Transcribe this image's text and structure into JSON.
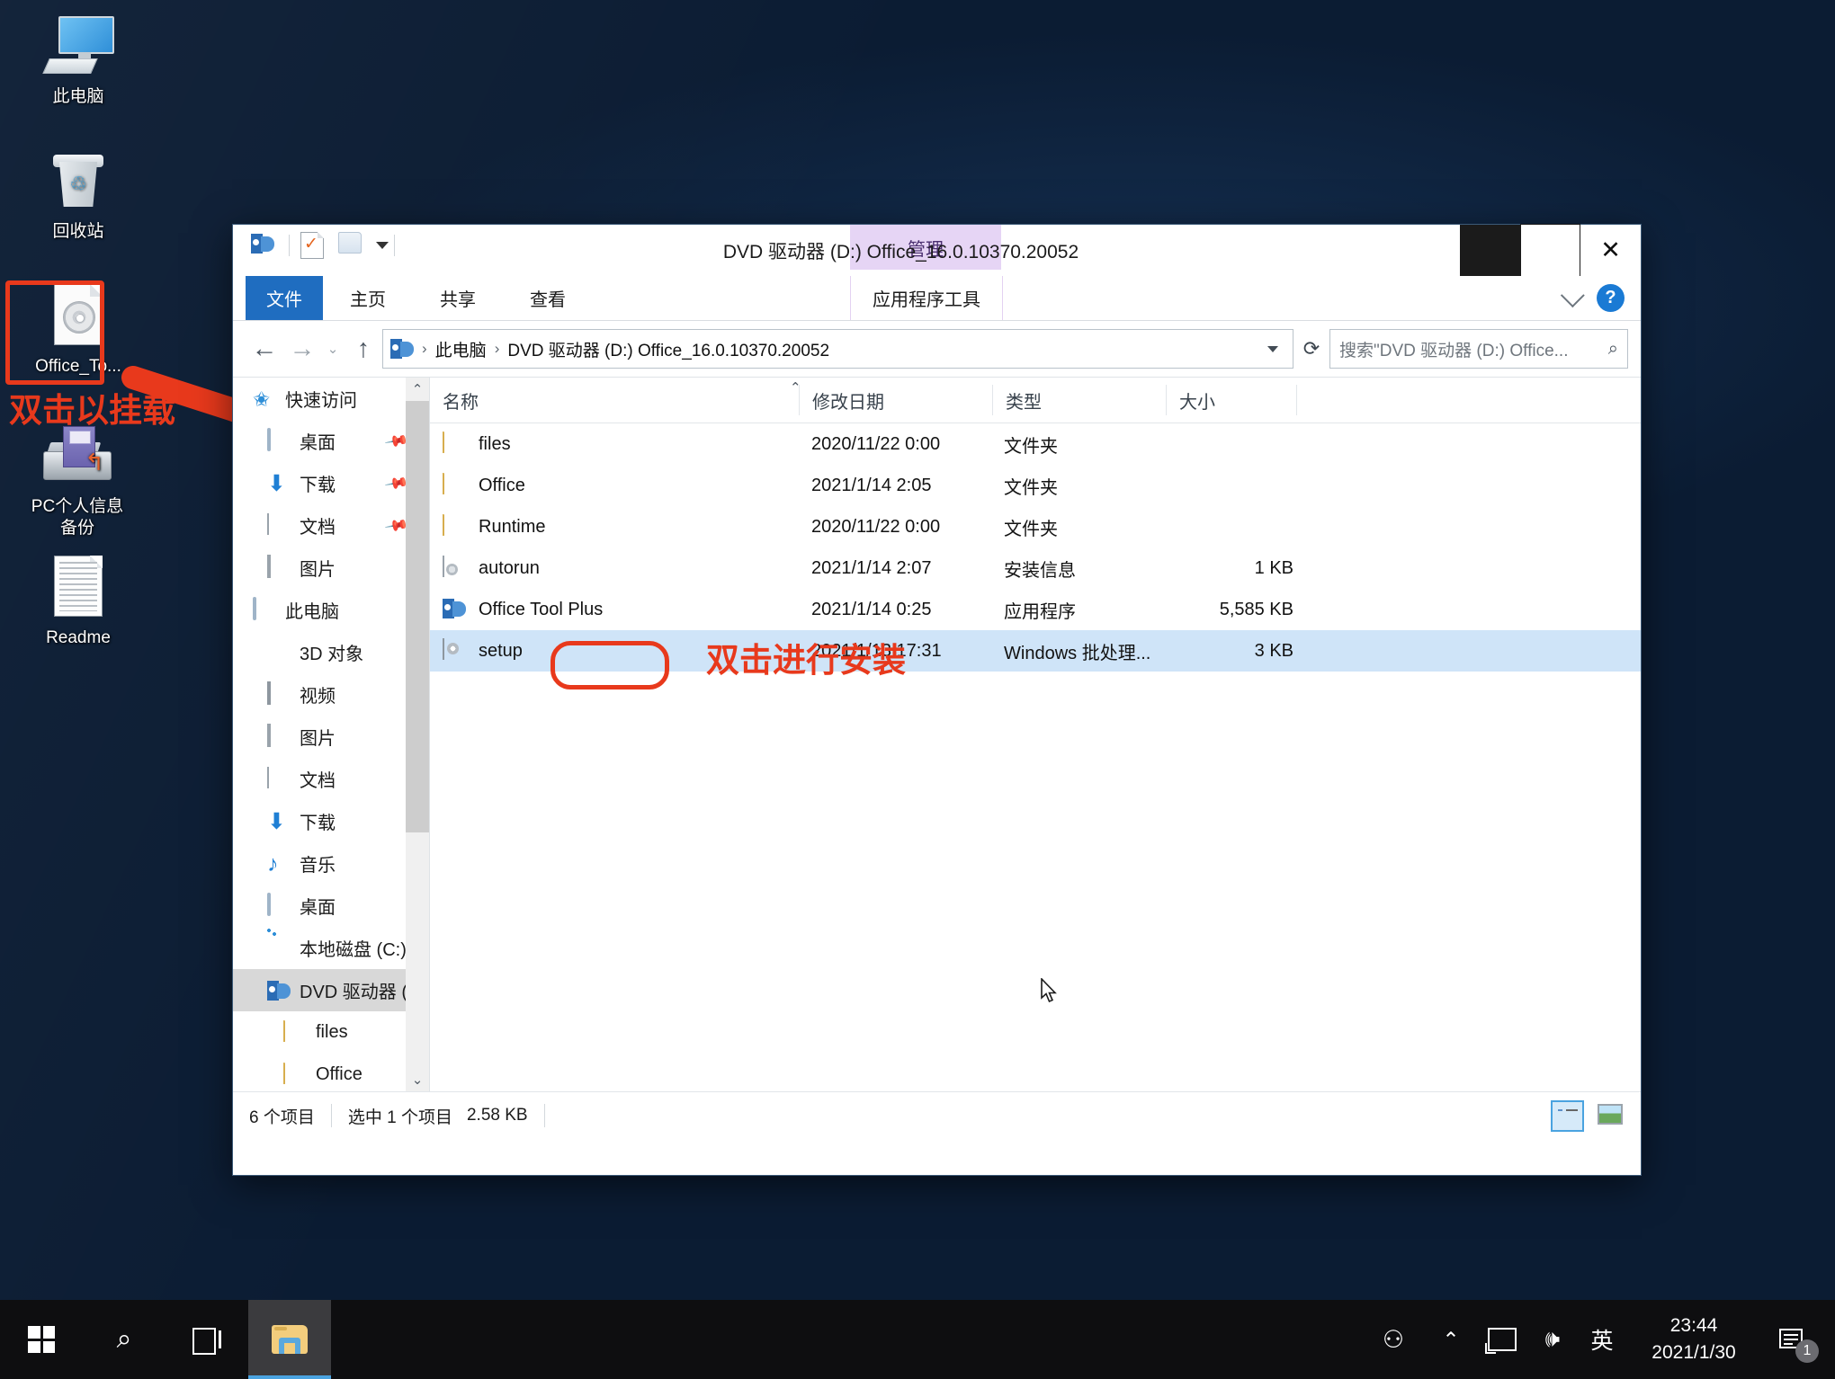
{
  "desktop": {
    "icons": [
      {
        "name": "此电脑",
        "icon": "computer-icon"
      },
      {
        "name": "回收站",
        "icon": "recycle-bin-icon"
      },
      {
        "name": "Office_To...",
        "icon": "disc-image-icon"
      },
      {
        "name": "PC个人信息\n备份",
        "line1": "PC个人信息",
        "line2": "备份",
        "icon": "backup-drive-icon"
      },
      {
        "name": "Readme",
        "icon": "text-document-icon"
      }
    ]
  },
  "annotations": {
    "mount_hint": "双击以挂载",
    "install_hint": "双击进行安装",
    "color": "#e8391c"
  },
  "window": {
    "title": "DVD 驱动器 (D:) Office_16.0.10370.20052",
    "contextual_tab_group": "管理",
    "tabs": [
      {
        "label": "文件",
        "active": true
      },
      {
        "label": "主页",
        "active": false
      },
      {
        "label": "共享",
        "active": false
      },
      {
        "label": "查看",
        "active": false
      },
      {
        "label": "应用程序工具",
        "active": false
      }
    ],
    "controls": {
      "minimize": "—",
      "maximize": "□",
      "close": "✕",
      "help": "?"
    },
    "address": {
      "crumbs": [
        "此电脑",
        "DVD 驱动器 (D:) Office_16.0.10370.20052"
      ],
      "separator": "›"
    },
    "search": {
      "placeholder": "搜索\"DVD 驱动器 (D:) Office...",
      "icon": "search-icon"
    },
    "nav": {
      "items": [
        {
          "label": "快速访问",
          "icon": "star-pin-icon",
          "indent": 0,
          "pinned": false,
          "selected": false
        },
        {
          "label": "桌面",
          "icon": "desktop-icon",
          "indent": 1,
          "pinned": true,
          "selected": false
        },
        {
          "label": "下载",
          "icon": "downloads-icon",
          "indent": 1,
          "pinned": true,
          "selected": false
        },
        {
          "label": "文档",
          "icon": "documents-icon",
          "indent": 1,
          "pinned": true,
          "selected": false
        },
        {
          "label": "图片",
          "icon": "pictures-icon",
          "indent": 1,
          "pinned": false,
          "selected": false
        },
        {
          "label": "此电脑",
          "icon": "this-pc-icon",
          "indent": 0,
          "pinned": false,
          "selected": false
        },
        {
          "label": "3D 对象",
          "icon": "3d-objects-icon",
          "indent": 1,
          "pinned": false,
          "selected": false
        },
        {
          "label": "视频",
          "icon": "videos-icon",
          "indent": 1,
          "pinned": false,
          "selected": false
        },
        {
          "label": "图片",
          "icon": "pictures-icon",
          "indent": 1,
          "pinned": false,
          "selected": false
        },
        {
          "label": "文档",
          "icon": "documents-icon",
          "indent": 1,
          "pinned": false,
          "selected": false
        },
        {
          "label": "下载",
          "icon": "downloads-icon",
          "indent": 1,
          "pinned": false,
          "selected": false
        },
        {
          "label": "音乐",
          "icon": "music-icon",
          "indent": 1,
          "pinned": false,
          "selected": false
        },
        {
          "label": "桌面",
          "icon": "desktop-icon",
          "indent": 1,
          "pinned": false,
          "selected": false
        },
        {
          "label": "本地磁盘 (C:)",
          "icon": "hard-disk-icon",
          "indent": 1,
          "pinned": false,
          "selected": false
        },
        {
          "label": "DVD 驱动器 (D:",
          "icon": "dvd-drive-icon",
          "indent": 1,
          "pinned": false,
          "selected": true
        },
        {
          "label": "files",
          "icon": "folder-icon",
          "indent": 2,
          "pinned": false,
          "selected": false
        },
        {
          "label": "Office",
          "icon": "folder-icon",
          "indent": 2,
          "pinned": false,
          "selected": false
        }
      ]
    },
    "columns": [
      {
        "label": "名称"
      },
      {
        "label": "修改日期"
      },
      {
        "label": "类型"
      },
      {
        "label": "大小"
      }
    ],
    "files": [
      {
        "name": "files",
        "date": "2020/11/22 0:00",
        "type": "文件夹",
        "size": "",
        "icon": "folder-icon",
        "selected": false
      },
      {
        "name": "Office",
        "date": "2021/1/14 2:05",
        "type": "文件夹",
        "size": "",
        "icon": "folder-icon",
        "selected": false
      },
      {
        "name": "Runtime",
        "date": "2020/11/22 0:00",
        "type": "文件夹",
        "size": "",
        "icon": "folder-icon",
        "selected": false
      },
      {
        "name": "autorun",
        "date": "2021/1/14 2:07",
        "type": "安装信息",
        "size": "1 KB",
        "icon": "setup-information-icon",
        "selected": false
      },
      {
        "name": "Office Tool Plus",
        "date": "2021/1/14 0:25",
        "type": "应用程序",
        "size": "5,585 KB",
        "icon": "application-icon",
        "selected": false
      },
      {
        "name": "setup",
        "date": "2021/1/13 17:31",
        "type": "Windows 批处理...",
        "size": "3 KB",
        "icon": "batch-file-icon",
        "selected": true
      }
    ],
    "status": {
      "item_count": "6 个项目",
      "selection": "选中 1 个项目",
      "selection_size": "2.58 KB"
    },
    "view_buttons": [
      {
        "name": "details-view",
        "active": true
      },
      {
        "name": "large-icons-view",
        "active": false
      }
    ]
  },
  "taskbar": {
    "start": "start-button",
    "search": "search-icon",
    "task_view": "task-view-icon",
    "explorer": "file-explorer-icon",
    "tray": {
      "people": "people-icon",
      "chevron": "show-hidden-icons-icon",
      "network": "network-icon",
      "volume": "volume-icon",
      "ime": "英",
      "time": "23:44",
      "date": "2021/1/30",
      "notifications_badge": "1"
    }
  }
}
